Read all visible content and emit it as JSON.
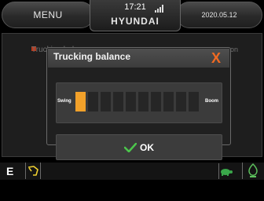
{
  "header": {
    "menu_label": "MENU",
    "time": "17:21",
    "brand": "HYUNDAI",
    "date": "2020.05.12"
  },
  "background": {
    "title_left": "Trucking balance",
    "title_right": "on"
  },
  "dialog": {
    "title": "Trucking balance",
    "close_glyph": "X",
    "left_label": "Swing",
    "right_label": "Boom",
    "segment_count": 10,
    "active_segment": 1,
    "ok_label": "OK"
  },
  "status_bar": {
    "mode": "E"
  },
  "colors": {
    "accent": "#f06a22",
    "active_segment": "#f2a12a",
    "check": "#4cc64c",
    "eco": "#5cc05c"
  },
  "icons": [
    "signal-icon",
    "close-icon",
    "checkmark-icon",
    "excavator-icon",
    "turtle-icon",
    "eco-icon"
  ]
}
